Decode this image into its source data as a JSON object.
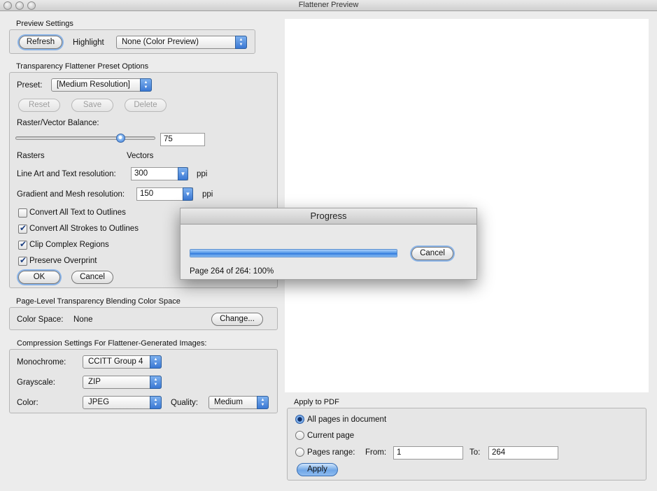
{
  "window": {
    "title": "Flattener Preview"
  },
  "preview_settings": {
    "label": "Preview Settings",
    "refresh": "Refresh",
    "highlight_label": "Highlight",
    "highlight_value": "None (Color Preview)"
  },
  "preset_options": {
    "label": "Transparency Flattener Preset Options",
    "preset_label": "Preset:",
    "preset_value": "[Medium Resolution]",
    "reset": "Reset",
    "save": "Save",
    "delete": "Delete",
    "balance_label": "Raster/Vector Balance:",
    "balance_value": "75",
    "balance_fraction": 0.75,
    "rasters": "Rasters",
    "vectors": "Vectors",
    "line_art_label": "Line Art and Text resolution:",
    "line_art_value": "300",
    "line_art_unit": "ppi",
    "gradient_label": "Gradient and Mesh resolution:",
    "gradient_value": "150",
    "gradient_unit": "ppi",
    "checkboxes": [
      {
        "label": "Convert All Text to Outlines",
        "checked": false
      },
      {
        "label": "Convert All Strokes to Outlines",
        "checked": true
      },
      {
        "label": "Clip Complex Regions",
        "checked": true
      },
      {
        "label": "Preserve Overprint",
        "checked": true
      }
    ],
    "ok": "OK",
    "cancel": "Cancel"
  },
  "blending": {
    "label": "Page-Level Transparency Blending Color Space",
    "color_space_label": "Color Space:",
    "color_space_value": "None",
    "change": "Change..."
  },
  "compression": {
    "label": "Compression Settings For Flattener-Generated Images:",
    "monochrome_label": "Monochrome:",
    "monochrome_value": "CCITT Group 4",
    "grayscale_label": "Grayscale:",
    "grayscale_value": "ZIP",
    "color_label": "Color:",
    "color_value": "JPEG",
    "quality_label": "Quality:",
    "quality_value": "Medium"
  },
  "apply_to_pdf": {
    "label": "Apply to PDF",
    "all_pages": "All pages in document",
    "current_page": "Current page",
    "pages_range": "Pages range:",
    "from_label": "From:",
    "from_value": "1",
    "to_label": "To:",
    "to_value": "264",
    "selected": "all_pages",
    "apply": "Apply"
  },
  "progress": {
    "title": "Progress",
    "cancel": "Cancel",
    "status": "Page 264 of 264: 100%",
    "fraction": 1.0
  }
}
